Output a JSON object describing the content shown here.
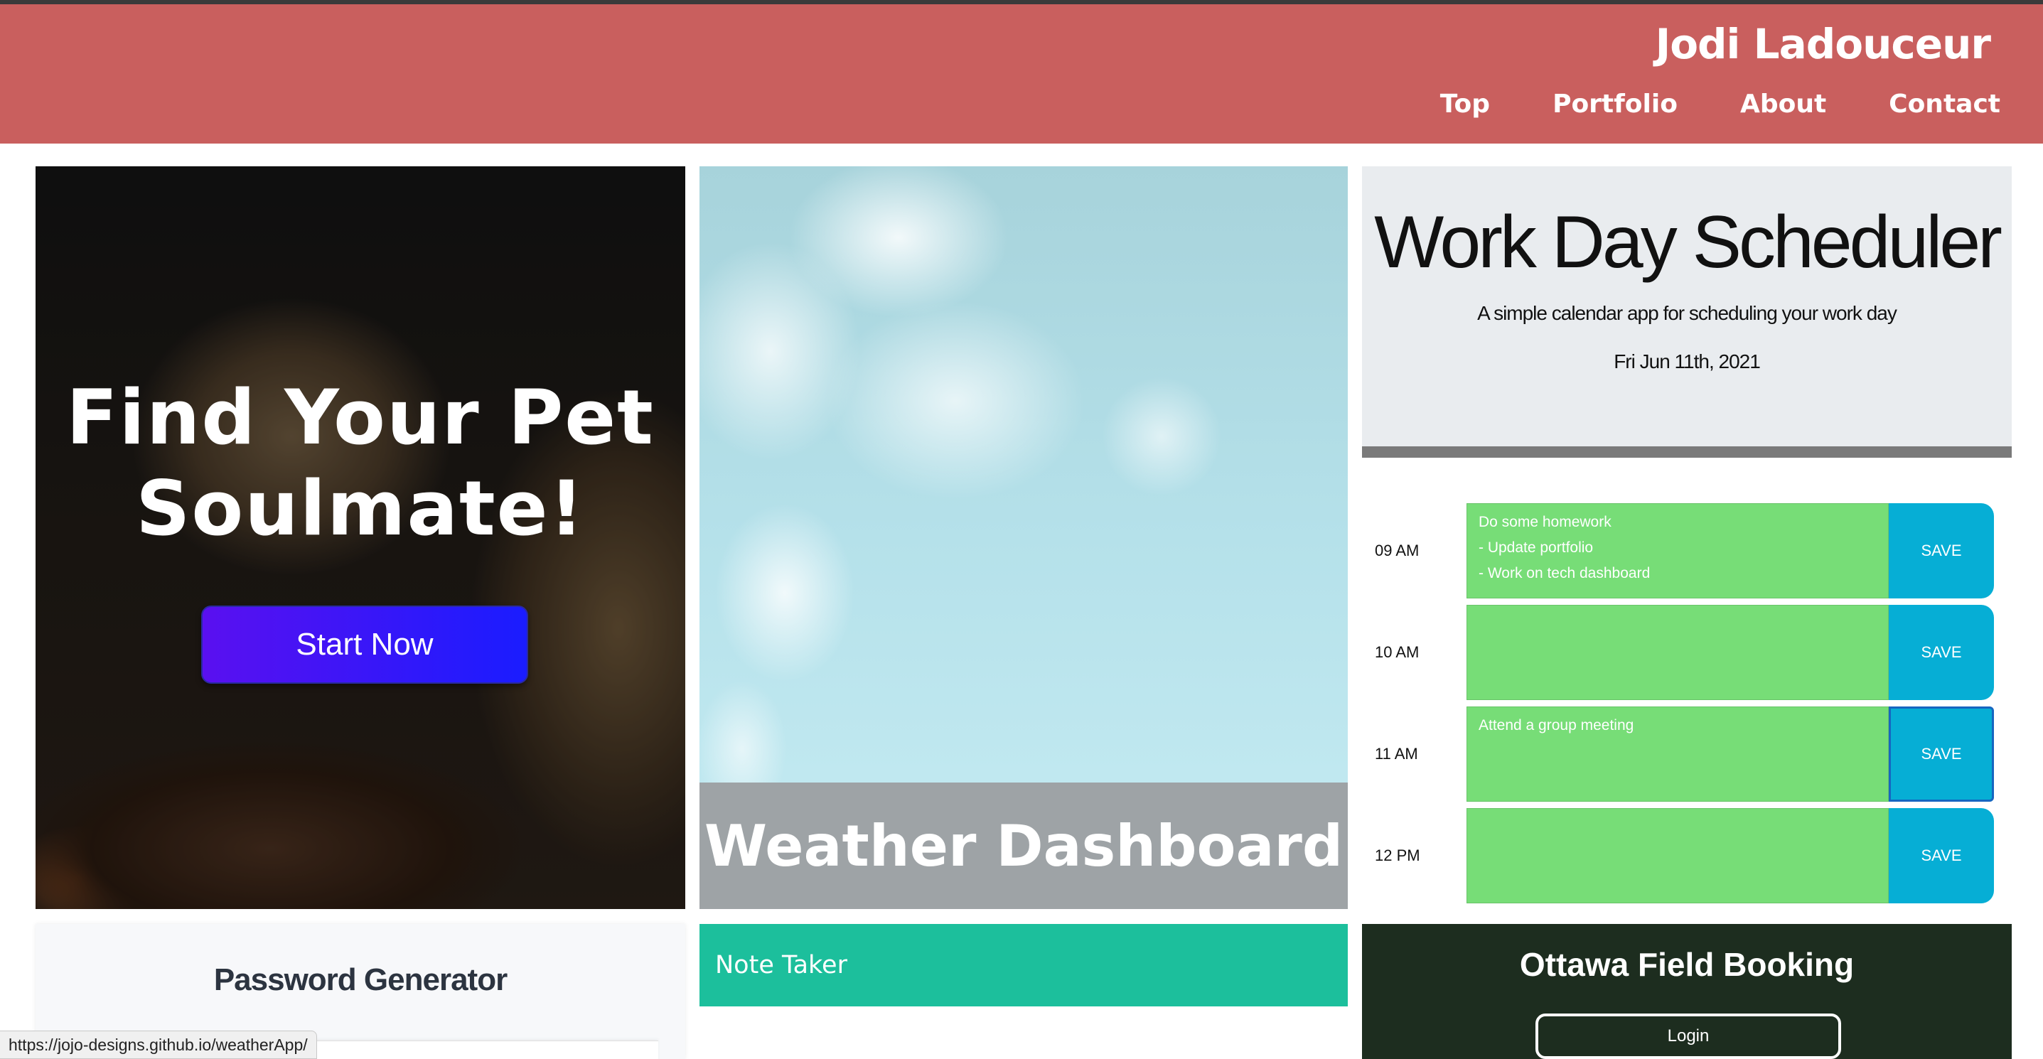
{
  "header": {
    "brand": "Jodi Ladouceur",
    "nav": [
      "Top",
      "Portfolio",
      "About",
      "Contact"
    ],
    "color": "#c95f5e"
  },
  "projects": {
    "pet": {
      "title": "Find Your Pet Soulmate!",
      "button": "Start Now"
    },
    "weather": {
      "title": "Weather Dashboard"
    },
    "scheduler": {
      "title": "Work Day Scheduler",
      "lead": "A simple calendar app for scheduling your work day",
      "date": "Fri Jun 11th, 2021",
      "save_label": "SAVE",
      "rows": [
        {
          "hour": "09 AM",
          "text": "Do some homework\n- Update portfolio\n- Work on tech dashboard"
        },
        {
          "hour": "10 AM",
          "text": ""
        },
        {
          "hour": "11 AM",
          "text": "Attend a group meeting"
        },
        {
          "hour": "12 PM",
          "text": ""
        }
      ],
      "row_color": "#77dd77",
      "save_color": "#06aed5"
    },
    "password": {
      "title": "Password Generator"
    },
    "note": {
      "title": "Note Taker",
      "color": "#1cbf9c"
    },
    "field": {
      "title": "Ottawa Field Booking",
      "button": "Login"
    }
  },
  "status_bar": {
    "url": "https://jojo-designs.github.io/weatherApp/"
  }
}
